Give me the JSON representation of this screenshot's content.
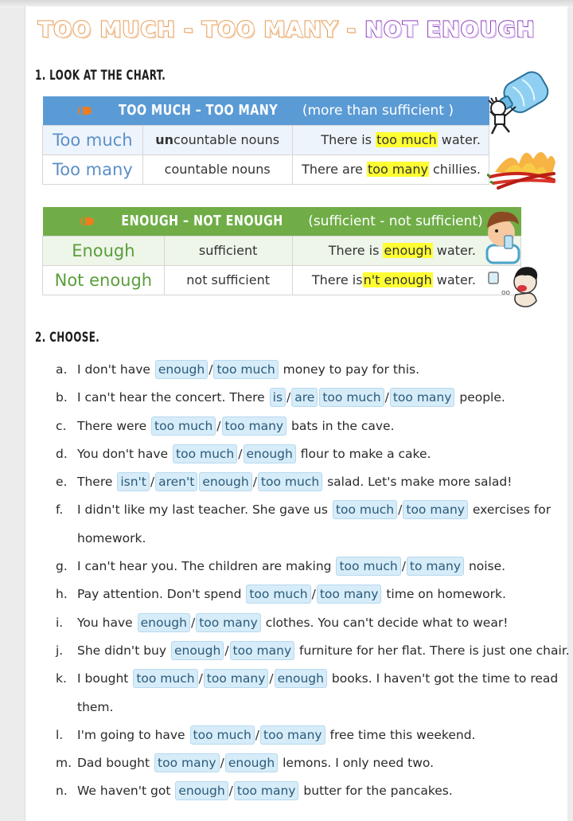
{
  "title": {
    "part1": "TOO MUCH - TOO MANY - ",
    "part2": "NOT ENOUGH",
    "colors": {
      "orange": "#e39a50",
      "purple": "#8a3fb8"
    }
  },
  "section1": {
    "heading": "1.  LOOK AT THE CHART.",
    "table_much_many": {
      "header_caps": "TOO MUCH – TOO MANY",
      "header_paren": "(more than sufficient )",
      "header_color": "#5b9bd5",
      "rows": [
        {
          "term": "Too much",
          "noun_bold": "un",
          "noun_rest": "countable nouns",
          "ex_pre": "There is ",
          "ex_hl": "too much",
          "ex_post": " water."
        },
        {
          "term": "Too many",
          "noun_bold": "",
          "noun_rest": "countable nouns",
          "ex_pre": "There are ",
          "ex_hl": "too many",
          "ex_post": " chillies."
        }
      ]
    },
    "table_enough": {
      "header_caps": "ENOUGH – NOT ENOUGH",
      "header_paren": "(sufficient - not sufficient)",
      "header_color": "#70ad47",
      "rows": [
        {
          "term": "Enough",
          "meaning": "sufficient",
          "ex_pre": "There is ",
          "ex_hl": "enough",
          "ex_post": " water."
        },
        {
          "term": "Not enough",
          "meaning": "not sufficient",
          "ex_pre": "There is",
          "ex_hl": "n't enough",
          "ex_post": " water."
        }
      ]
    },
    "images": [
      "water-bottle-man-icon",
      "chillies-fire-icon",
      "boy-drinking-icon",
      "thirsty-boy-icon"
    ]
  },
  "section2": {
    "heading": "2.  CHOOSE.",
    "items": [
      {
        "letter": "a.",
        "parts": [
          "I don't have ",
          {
            "o": "enough"
          },
          "/",
          {
            "o": "too much"
          },
          " money to pay for this."
        ]
      },
      {
        "letter": "b.",
        "parts": [
          "I can't hear the concert. There ",
          {
            "o": "is"
          },
          "/",
          {
            "o": "are"
          },
          {
            "o": "too much"
          },
          "/",
          {
            "o": "too many"
          },
          " people."
        ]
      },
      {
        "letter": "c.",
        "parts": [
          "There were ",
          {
            "o": "too much"
          },
          "/",
          {
            "o": "too many"
          },
          " bats in the cave."
        ]
      },
      {
        "letter": "d.",
        "parts": [
          "You don't have ",
          {
            "o": "too much"
          },
          "/",
          {
            "o": "enough"
          },
          " flour to make a cake."
        ]
      },
      {
        "letter": "e.",
        "parts": [
          "There ",
          {
            "o": "isn't"
          },
          "/",
          {
            "o": "aren't"
          },
          {
            "o": "enough"
          },
          "/",
          {
            "o": "too much"
          },
          " salad. Let's make more salad!"
        ]
      },
      {
        "letter": "f.",
        "parts": [
          "I didn't like my last teacher. She gave us ",
          {
            "o": "too much"
          },
          "/",
          {
            "o": "too many"
          },
          " exercises for"
        ],
        "cont": "homework."
      },
      {
        "letter": "g.",
        "parts": [
          "I can't hear you. The children are making ",
          {
            "o": "too much"
          },
          "/",
          {
            "o": "to many"
          },
          " noise."
        ]
      },
      {
        "letter": "h.",
        "parts": [
          "Pay attention. Don't spend ",
          {
            "o": "too much"
          },
          "/",
          {
            "o": "too many"
          },
          " time on homework."
        ]
      },
      {
        "letter": "i.",
        "parts": [
          "You have ",
          {
            "o": "enough"
          },
          "/",
          {
            "o": "too many"
          },
          " clothes. You can't decide what to wear!"
        ]
      },
      {
        "letter": "j.",
        "parts": [
          "She didn't buy ",
          {
            "o": "enough"
          },
          "/",
          {
            "o": "too many"
          },
          " furniture for her flat. There is just one chair."
        ]
      },
      {
        "letter": "k.",
        "parts": [
          "I bought ",
          {
            "o": "too much"
          },
          "/",
          {
            "o": "too many"
          },
          "/",
          {
            "o": "enough"
          },
          " books. I haven't got the time to read"
        ],
        "cont": "them."
      },
      {
        "letter": "l.",
        "parts": [
          "I'm going to have ",
          {
            "o": "too much"
          },
          "/",
          {
            "o": "too many"
          },
          " free time this weekend."
        ]
      },
      {
        "letter": "m.",
        "parts": [
          "Dad bought ",
          {
            "o": "too many"
          },
          "/",
          {
            "o": "enough"
          },
          " lemons. I only need two."
        ]
      },
      {
        "letter": "n.",
        "parts": [
          "We haven't got ",
          {
            "o": "enough"
          },
          "/",
          {
            "o": "too many"
          },
          " butter for the pancakes."
        ]
      }
    ]
  }
}
